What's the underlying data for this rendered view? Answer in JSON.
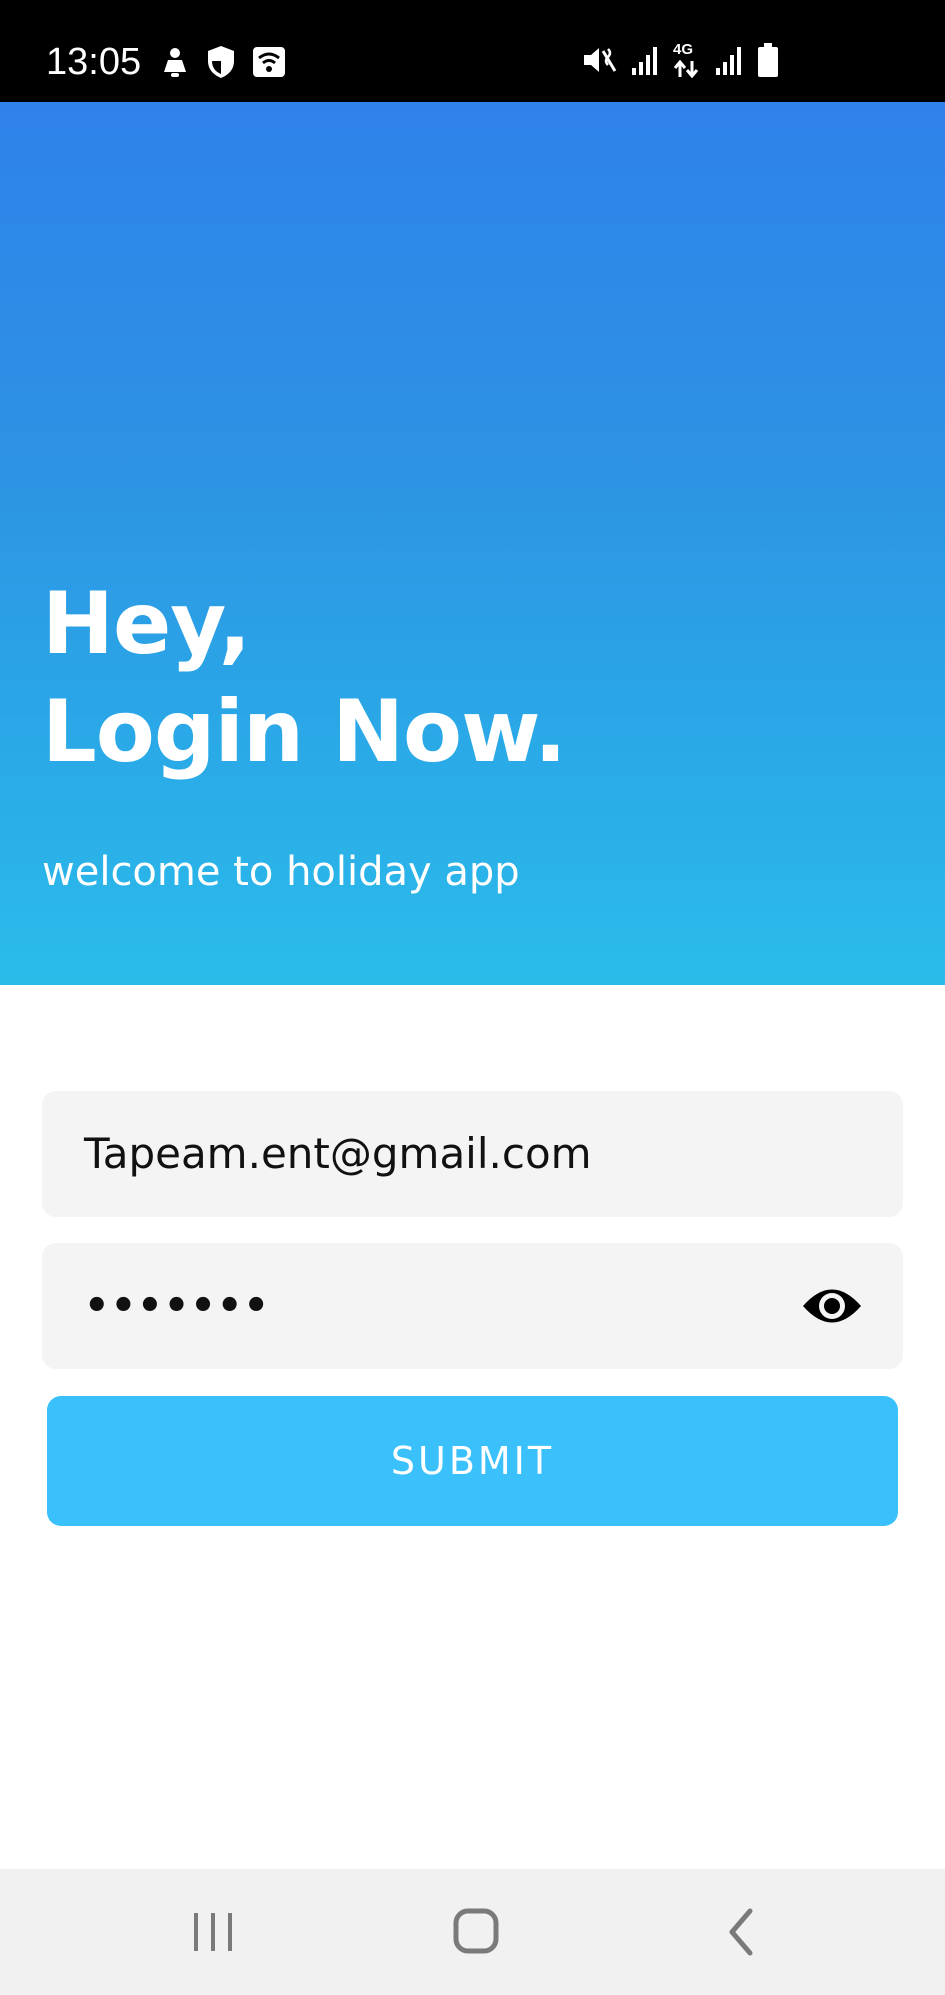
{
  "status_bar": {
    "time": "13:05",
    "icons_left": [
      "notification-icon",
      "shield-icon",
      "wifi-hotspot-icon"
    ],
    "icons_right": [
      "mute-vibrate-icon",
      "signal-icon",
      "4g-data-icon",
      "signal-icon",
      "battery-icon"
    ],
    "network_label": "4G"
  },
  "hero": {
    "title_line1": "Hey,",
    "title_line2": "Login Now.",
    "subtitle": "welcome to holiday app",
    "gradient_colors": [
      "#2f82ea",
      "#2bbcea"
    ]
  },
  "form": {
    "email_value": "Tapeam.ent@gmail.com",
    "password_value": "•••••••",
    "password_toggle_icon": "eye-icon",
    "submit_label": "SUBMIT",
    "submit_color": "#3ac1fb",
    "field_background": "#f4f4f4"
  },
  "nav_bar": {
    "buttons": [
      "recents-icon",
      "home-icon",
      "back-icon"
    ]
  }
}
